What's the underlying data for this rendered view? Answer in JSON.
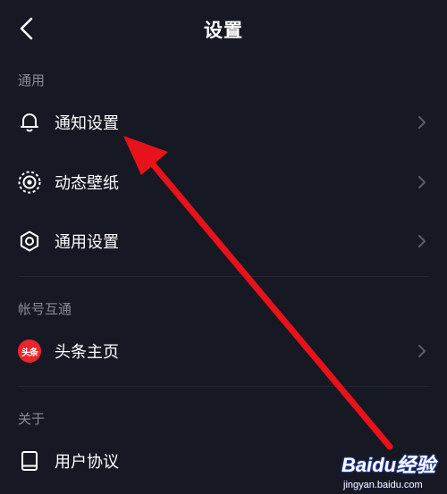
{
  "header": {
    "title": "设置",
    "back_icon": "chevron-left-icon"
  },
  "sections": [
    {
      "label": "通用",
      "items": [
        {
          "label": "通知设置",
          "icon": "bell-icon"
        },
        {
          "label": "动态壁纸",
          "icon": "live-wallpaper-icon"
        },
        {
          "label": "通用设置",
          "icon": "gear-icon"
        }
      ]
    },
    {
      "label": "帐号互通",
      "items": [
        {
          "label": "头条主页",
          "icon": "toutiao-logo-icon",
          "logo_text": "头条"
        }
      ]
    },
    {
      "label": "关于",
      "items": [
        {
          "label": "用户协议",
          "icon": "book-icon"
        }
      ]
    }
  ],
  "annotation": {
    "arrow_color": "#e8121a"
  },
  "watermark": {
    "line1": "Baidu经验",
    "line2": "jingyan.baidu.com"
  },
  "colors": {
    "background": "#161823",
    "text_primary": "#ffffff",
    "text_secondary": "#8a8b91",
    "chevron": "#5c5d66",
    "divider": "#25262f"
  }
}
